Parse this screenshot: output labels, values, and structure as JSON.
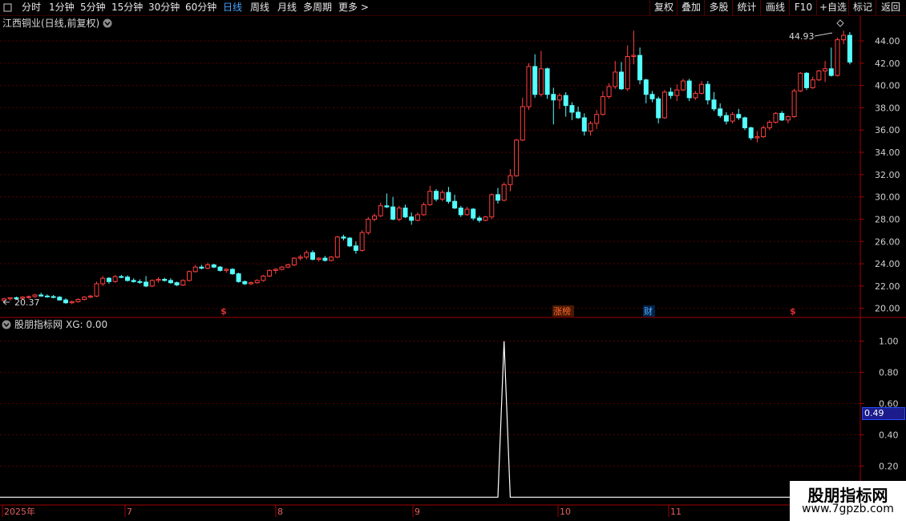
{
  "toolbar": {
    "menu_icon": "window-menu-icon",
    "tabs": [
      "分时",
      "1分钟",
      "5分钟",
      "15分钟",
      "30分钟",
      "60分钟",
      "日线",
      "周线",
      "月线",
      "多周期",
      "更多"
    ],
    "active_tab": "日线",
    "right_buttons": [
      "复权",
      "叠加",
      "多股",
      "统计",
      "画线",
      "F10",
      "+自选",
      "标记",
      "返回"
    ]
  },
  "main_panel": {
    "stock_title": "江西铜业(日线,前复权)",
    "dropdown_icon": "chevron-down-icon",
    "settings_icon": "diamond-icon",
    "max_label": "44.93",
    "min_label": "20.37",
    "markers": [
      {
        "text": "$",
        "color": "#e03030"
      },
      {
        "text": "涨榜",
        "color": "#ff6633"
      },
      {
        "text": "财",
        "color": "#5ab0ff"
      },
      {
        "text": "$",
        "color": "#e03030"
      }
    ]
  },
  "indicator_panel": {
    "name": "股朋指标网",
    "formula_label": "XG: 0.00",
    "value_box": "0.49",
    "yticks": [
      "1.00",
      "0.80",
      "0.60",
      "0.40",
      "0.20"
    ]
  },
  "x_axis": {
    "labels": [
      "2025年",
      "7",
      "8",
      "9",
      "10",
      "11"
    ]
  },
  "watermark": {
    "title": "股朋指标网",
    "url": "www.7gpzb.com"
  },
  "colors": {
    "up": "#ff4040",
    "down": "#54ffff",
    "grid": "#5a0000",
    "accent": "#4aa3ff"
  },
  "chart_data": [
    {
      "type": "candlestick",
      "title": "江西铜业(日线,前复权)",
      "yticks": [
        20,
        22,
        24,
        26,
        28,
        30,
        32,
        34,
        36,
        38,
        40,
        42,
        44
      ],
      "ylim": [
        19.4,
        45.8
      ],
      "grid": true,
      "max_annotation": 44.93,
      "min_annotation": 20.37,
      "ohlc": [
        [
          20.7,
          20.95,
          20.45,
          20.85
        ],
        [
          20.85,
          21.0,
          20.7,
          20.95
        ],
        [
          20.95,
          21.05,
          20.8,
          20.9
        ],
        [
          20.9,
          21.1,
          20.8,
          21.0
        ],
        [
          21.0,
          21.15,
          20.85,
          21.05
        ],
        [
          21.05,
          21.3,
          20.95,
          21.2
        ],
        [
          21.2,
          21.4,
          21.05,
          21.1
        ],
        [
          21.1,
          21.25,
          20.95,
          21.05
        ],
        [
          21.05,
          21.2,
          20.9,
          21.0
        ],
        [
          21.0,
          21.1,
          20.7,
          20.75
        ],
        [
          20.75,
          20.9,
          20.4,
          20.5
        ],
        [
          20.5,
          20.7,
          20.37,
          20.6
        ],
        [
          20.6,
          20.9,
          20.5,
          20.8
        ],
        [
          20.8,
          21.1,
          20.7,
          21.0
        ],
        [
          21.0,
          21.2,
          20.9,
          21.1
        ],
        [
          21.1,
          22.4,
          21.0,
          22.2
        ],
        [
          22.2,
          22.9,
          22.0,
          22.7
        ],
        [
          22.7,
          22.8,
          22.2,
          22.4
        ],
        [
          22.4,
          23.0,
          22.3,
          22.85
        ],
        [
          22.85,
          23.0,
          22.7,
          22.8
        ],
        [
          22.8,
          22.95,
          22.4,
          22.5
        ],
        [
          22.5,
          22.7,
          22.3,
          22.4
        ],
        [
          22.4,
          22.6,
          22.2,
          22.35
        ],
        [
          22.35,
          22.9,
          21.9,
          22.0
        ],
        [
          22.0,
          22.6,
          21.9,
          22.5
        ],
        [
          22.5,
          22.8,
          22.3,
          22.6
        ],
        [
          22.6,
          22.75,
          22.4,
          22.5
        ],
        [
          22.5,
          22.7,
          22.2,
          22.3
        ],
        [
          22.3,
          22.4,
          22.0,
          22.1
        ],
        [
          22.1,
          22.6,
          22.0,
          22.5
        ],
        [
          22.5,
          23.4,
          22.4,
          23.3
        ],
        [
          23.3,
          23.9,
          23.2,
          23.7
        ],
        [
          23.7,
          23.9,
          23.5,
          23.6
        ],
        [
          23.6,
          24.1,
          23.5,
          23.9
        ],
        [
          23.9,
          24.0,
          23.6,
          23.7
        ],
        [
          23.7,
          23.8,
          23.3,
          23.4
        ],
        [
          23.4,
          23.6,
          23.2,
          23.5
        ],
        [
          23.5,
          23.6,
          23.0,
          23.1
        ],
        [
          23.1,
          23.2,
          22.3,
          22.4
        ],
        [
          22.4,
          22.5,
          22.1,
          22.2
        ],
        [
          22.2,
          22.4,
          22.1,
          22.3
        ],
        [
          22.3,
          22.6,
          22.2,
          22.5
        ],
        [
          22.5,
          23.0,
          22.4,
          22.9
        ],
        [
          22.9,
          23.5,
          22.8,
          23.4
        ],
        [
          23.4,
          23.6,
          23.1,
          23.5
        ],
        [
          23.5,
          23.8,
          23.4,
          23.7
        ],
        [
          23.7,
          24.0,
          23.6,
          23.9
        ],
        [
          23.9,
          24.6,
          23.8,
          24.5
        ],
        [
          24.5,
          24.8,
          24.3,
          24.6
        ],
        [
          24.6,
          25.2,
          24.4,
          25.0
        ],
        [
          25.0,
          25.2,
          24.3,
          24.4
        ],
        [
          24.4,
          24.6,
          24.2,
          24.5
        ],
        [
          24.5,
          24.7,
          24.2,
          24.3
        ],
        [
          24.3,
          24.7,
          24.2,
          24.6
        ],
        [
          24.6,
          26.5,
          24.5,
          26.4
        ],
        [
          26.4,
          26.6,
          26.1,
          26.3
        ],
        [
          26.3,
          26.4,
          25.5,
          25.6
        ],
        [
          25.6,
          26.0,
          24.9,
          25.2
        ],
        [
          25.2,
          27.0,
          25.1,
          26.8
        ],
        [
          26.8,
          28.2,
          26.6,
          28.0
        ],
        [
          28.0,
          28.5,
          27.8,
          28.3
        ],
        [
          28.3,
          29.5,
          28.2,
          29.2
        ],
        [
          29.2,
          30.3,
          29.0,
          29.1
        ],
        [
          29.1,
          30.0,
          27.9,
          28.0
        ],
        [
          28.0,
          29.2,
          27.8,
          29.0
        ],
        [
          29.0,
          29.3,
          28.1,
          28.2
        ],
        [
          28.2,
          28.6,
          27.5,
          27.9
        ],
        [
          27.9,
          28.6,
          27.8,
          28.4
        ],
        [
          28.4,
          29.5,
          28.3,
          29.3
        ],
        [
          29.3,
          31.0,
          29.2,
          30.5
        ],
        [
          30.5,
          30.7,
          29.6,
          29.8
        ],
        [
          29.8,
          30.6,
          29.6,
          30.4
        ],
        [
          30.4,
          30.9,
          29.4,
          29.6
        ],
        [
          29.6,
          30.2,
          28.9,
          29.0
        ],
        [
          29.0,
          29.2,
          28.2,
          28.4
        ],
        [
          28.4,
          29.1,
          28.3,
          28.9
        ],
        [
          28.9,
          29.0,
          27.9,
          28.1
        ],
        [
          28.1,
          28.3,
          27.7,
          27.9
        ],
        [
          27.9,
          28.3,
          27.8,
          28.2
        ],
        [
          28.2,
          30.3,
          28.0,
          30.2
        ],
        [
          30.2,
          30.8,
          29.4,
          29.7
        ],
        [
          29.7,
          31.3,
          29.6,
          31.1
        ],
        [
          31.1,
          32.5,
          30.5,
          31.9
        ],
        [
          31.9,
          35.2,
          31.8,
          35.1
        ],
        [
          35.1,
          38.9,
          35.0,
          38.1
        ],
        [
          38.1,
          42.0,
          37.8,
          41.7
        ],
        [
          41.7,
          42.8,
          38.9,
          39.2
        ],
        [
          39.2,
          43.1,
          39.0,
          41.5
        ],
        [
          41.5,
          41.6,
          38.8,
          39.2
        ],
        [
          39.2,
          39.8,
          36.5,
          38.7
        ],
        [
          38.7,
          39.3,
          37.9,
          39.1
        ],
        [
          39.1,
          39.4,
          37.2,
          38.2
        ],
        [
          38.2,
          38.5,
          36.9,
          37.6
        ],
        [
          37.6,
          38.1,
          37.0,
          37.1
        ],
        [
          37.1,
          37.5,
          35.5,
          35.9
        ],
        [
          35.9,
          36.8,
          35.5,
          36.6
        ],
        [
          36.6,
          37.8,
          36.1,
          37.4
        ],
        [
          37.4,
          39.5,
          37.3,
          39.0
        ],
        [
          39.0,
          40.2,
          38.8,
          39.9
        ],
        [
          39.9,
          42.2,
          39.7,
          41.2
        ],
        [
          41.2,
          42.1,
          39.6,
          39.7
        ],
        [
          39.7,
          43.6,
          39.5,
          42.6
        ],
        [
          42.6,
          44.93,
          41.9,
          42.7
        ],
        [
          42.7,
          43.4,
          40.1,
          40.5
        ],
        [
          40.5,
          40.6,
          38.4,
          39.2
        ],
        [
          39.2,
          39.5,
          38.5,
          38.8
        ],
        [
          38.8,
          39.0,
          36.6,
          37.1
        ],
        [
          37.1,
          39.6,
          37.0,
          39.4
        ],
        [
          39.4,
          39.8,
          38.8,
          39.1
        ],
        [
          39.1,
          40.1,
          38.6,
          39.6
        ],
        [
          39.6,
          40.6,
          39.5,
          40.4
        ],
        [
          40.4,
          40.6,
          38.6,
          38.9
        ],
        [
          38.9,
          39.5,
          38.7,
          39.3
        ],
        [
          39.3,
          40.4,
          39.2,
          40.1
        ],
        [
          40.1,
          40.4,
          38.3,
          38.7
        ],
        [
          38.7,
          39.4,
          37.7,
          37.9
        ],
        [
          37.9,
          38.4,
          37.1,
          37.3
        ],
        [
          37.3,
          37.6,
          36.5,
          36.8
        ],
        [
          36.8,
          37.6,
          36.6,
          37.4
        ],
        [
          37.4,
          37.9,
          36.9,
          37.1
        ],
        [
          37.1,
          37.2,
          36.0,
          36.2
        ],
        [
          36.2,
          36.3,
          35.1,
          35.3
        ],
        [
          35.3,
          35.9,
          34.9,
          35.4
        ],
        [
          35.4,
          36.4,
          35.3,
          36.2
        ],
        [
          36.2,
          36.9,
          36.0,
          36.7
        ],
        [
          36.7,
          37.6,
          36.6,
          37.5
        ],
        [
          37.5,
          37.7,
          36.8,
          36.9
        ],
        [
          36.9,
          37.3,
          36.6,
          37.2
        ],
        [
          37.2,
          39.7,
          37.1,
          39.5
        ],
        [
          39.5,
          41.2,
          39.4,
          41.1
        ],
        [
          41.1,
          41.2,
          39.6,
          39.8
        ],
        [
          39.8,
          40.8,
          39.7,
          40.5
        ],
        [
          40.5,
          41.4,
          40.4,
          41.3
        ],
        [
          41.3,
          42.2,
          40.3,
          41.5
        ],
        [
          41.5,
          43.4,
          40.8,
          40.9
        ],
        [
          40.9,
          44.3,
          40.8,
          44.1
        ],
        [
          44.1,
          44.93,
          43.7,
          44.5
        ],
        [
          44.5,
          44.8,
          41.9,
          42.1
        ]
      ]
    },
    {
      "type": "line",
      "title": "股朋指标网",
      "series": [
        {
          "name": "XG",
          "spike_index": 81,
          "spike_value": 1.0
        }
      ],
      "yticks": [
        1.0,
        0.8,
        0.6,
        0.4,
        0.2
      ],
      "ylim": [
        -0.05,
        1.08
      ]
    }
  ]
}
